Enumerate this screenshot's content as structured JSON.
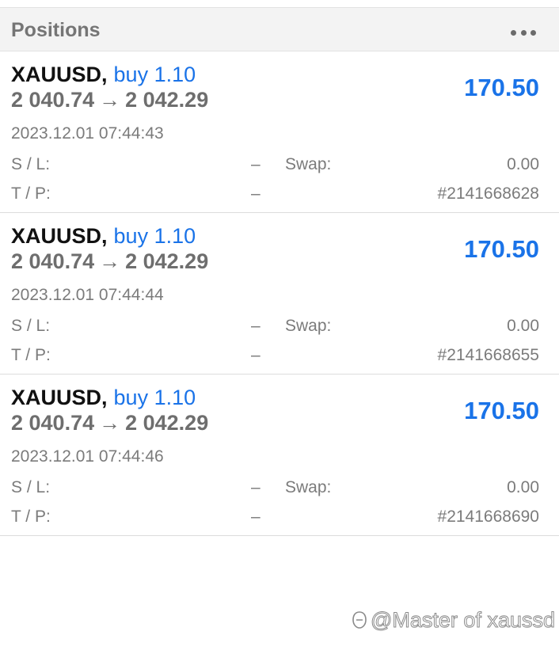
{
  "header": {
    "title": "Positions",
    "menu_icon": "more-horizontal-icon"
  },
  "positions": [
    {
      "symbol": "XAUUSD",
      "side": "buy 1.10",
      "open_price": "2 040.74",
      "arrow": "→",
      "current_price": "2 042.29",
      "profit": "170.50",
      "time": "2023.12.01 07:44:43",
      "sl_label": "S / L:",
      "sl_value": "–",
      "tp_label": "T / P:",
      "tp_value": "–",
      "swap_label": "Swap:",
      "swap_value": "0.00",
      "ticket": "#2141668628"
    },
    {
      "symbol": "XAUUSD",
      "side": "buy 1.10",
      "open_price": "2 040.74",
      "arrow": "→",
      "current_price": "2 042.29",
      "profit": "170.50",
      "time": "2023.12.01 07:44:44",
      "sl_label": "S / L:",
      "sl_value": "–",
      "tp_label": "T / P:",
      "tp_value": "–",
      "swap_label": "Swap:",
      "swap_value": "0.00",
      "ticket": "#2141668655"
    },
    {
      "symbol": "XAUUSD",
      "side": "buy 1.10",
      "open_price": "2 040.74",
      "arrow": "→",
      "current_price": "2 042.29",
      "profit": "170.50",
      "time": "2023.12.01 07:44:46",
      "sl_label": "S / L:",
      "sl_value": "–",
      "tp_label": "T / P:",
      "tp_value": "–",
      "swap_label": "Swap:",
      "swap_value": "0.00",
      "ticket": "#2141668690"
    }
  ],
  "watermark": {
    "text": "@Master of xaussd"
  },
  "colors": {
    "accent": "#1a73e8",
    "header_bg": "#f3f3f3",
    "muted_text": "#7b7b7b"
  }
}
